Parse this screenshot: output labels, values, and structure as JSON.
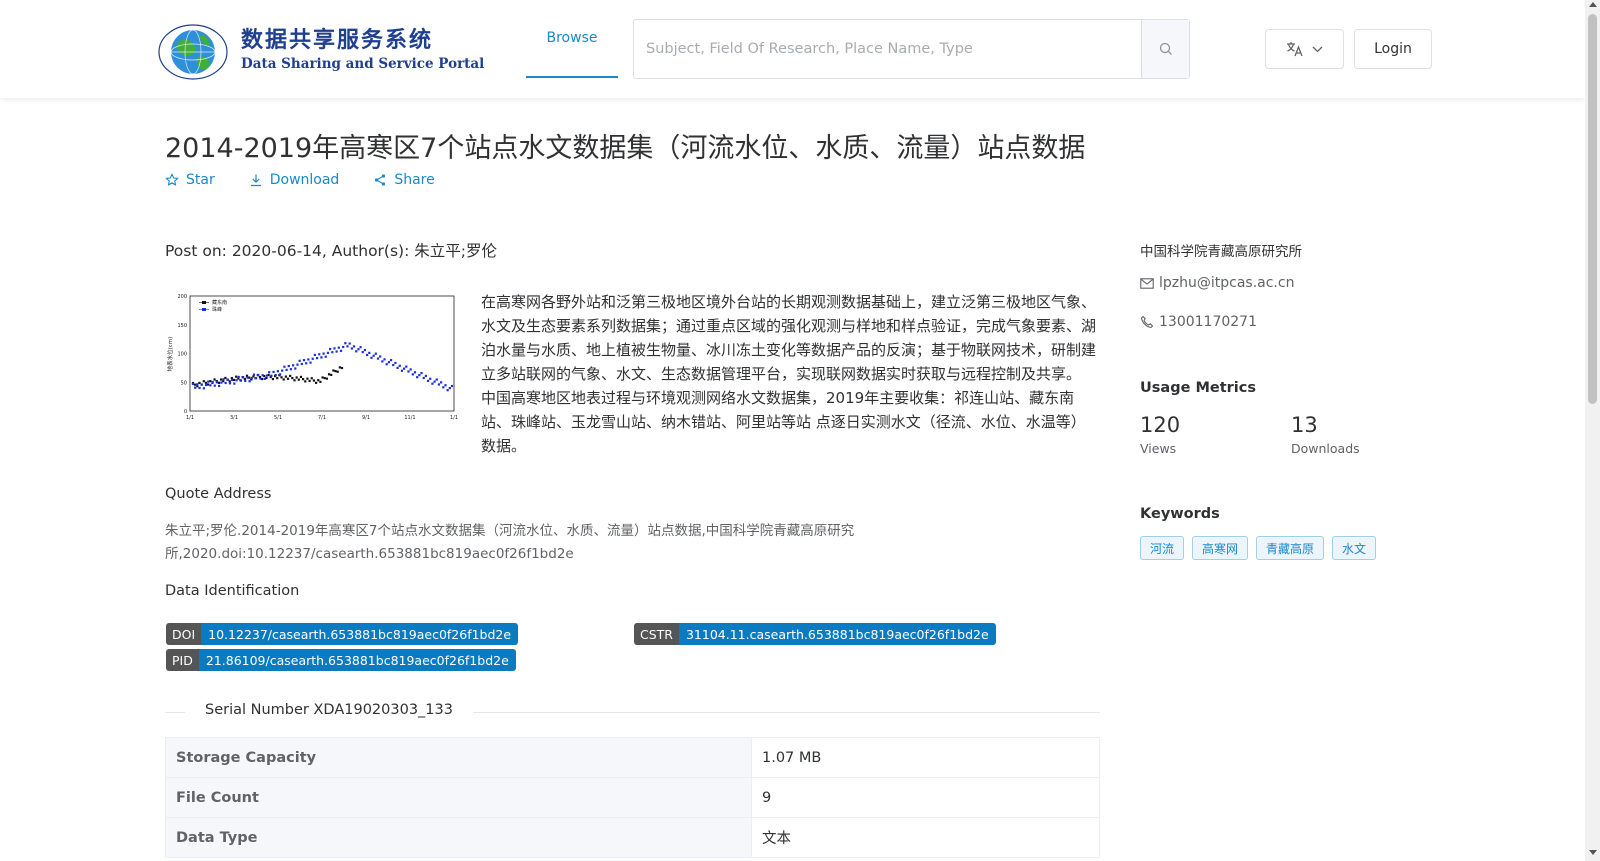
{
  "header": {
    "logo": {
      "cn": "数据共享服务系统",
      "en": "Data Sharing and Service Portal",
      "ring_text_top": "地球大数据科学数据中心",
      "ring_text_bottom": "Big Earth Data Center,CAS"
    },
    "nav_browse": "Browse",
    "search_placeholder": "Subject, Field Of Research, Place Name, Type",
    "login": "Login"
  },
  "dataset": {
    "title": "2014-2019年高寒区7个站点水文数据集（河流水位、水质、流量）站点数据",
    "actions": {
      "star": "Star",
      "download": "Download",
      "share": "Share"
    },
    "post_line": "Post on: 2020-06-14, Author(s): 朱立平;罗伦",
    "description": "在高寒网各野外站和泛第三极地区境外台站的长期观测数据基础上，建立泛第三极地区气象、水文及生态要素系列数据集；通过重点区域的强化观测与样地和样点验证，完成气象要素、湖泊水量与水质、地上植被生物量、冰川冻土变化等数据产品的反演；基于物联网技术，研制建立多站联网的气象、水文、生态数据管理平台，实现联网数据实时获取与远程控制及共享。 中国高寒地区地表过程与环境观测网络水文数据集，2019年主要收集：祁连山站、藏东南站、珠峰站、玉龙雪山站、纳木错站、阿里站等站 点逐日实测水文（径流、水位、水温等）数据。",
    "thumbnail": {
      "y_ticks": [
        "200",
        "150",
        "100",
        "50",
        "0"
      ],
      "x_ticks": [
        "1/1",
        "3/1",
        "5/1",
        "7/1",
        "9/1",
        "11/1",
        "1/1"
      ],
      "ylabel": "地表水位(cm)",
      "legend": [
        "藏东南",
        "珠峰"
      ],
      "series_colors": [
        "#111111",
        "#1a2ee0"
      ]
    },
    "quote_label": "Quote Address",
    "quote_text": "朱立平;罗伦.2014-2019年高寒区7个站点水文数据集（河流水位、水质、流量）站点数据,中国科学院青藏高原研究所,2020.doi:10.12237/casearth.653881bc819aec0f26f1bd2e",
    "identification_label": "Data Identification",
    "identifiers": {
      "doi": {
        "key": "DOI",
        "value": "10.12237/casearth.653881bc819aec0f26f1bd2e"
      },
      "cstr": {
        "key": "CSTR",
        "value": "31104.11.casearth.653881bc819aec0f26f1bd2e"
      },
      "pid": {
        "key": "PID",
        "value": "21.86109/casearth.653881bc819aec0f26f1bd2e"
      }
    },
    "serial": "Serial Number XDA19020303_133",
    "info": [
      {
        "key": "Storage Capacity",
        "value": "1.07 MB"
      },
      {
        "key": "File Count",
        "value": "9"
      },
      {
        "key": "Data Type",
        "value": "文本"
      }
    ]
  },
  "sidebar": {
    "org": "中国科学院青藏高原研究所",
    "email": "lpzhu@itpcas.ac.cn",
    "phone": "13001170271",
    "usage_heading": "Usage Metrics",
    "views": {
      "value": "120",
      "label": "Views"
    },
    "downloads": {
      "value": "13",
      "label": "Downloads"
    },
    "keywords_heading": "Keywords",
    "keywords": [
      "河流",
      "高寒网",
      "青藏高原",
      "水文"
    ]
  },
  "colors": {
    "accent": "#1989c9",
    "badge_value_bg": "#0a7bc1",
    "badge_key_bg": "#555555"
  },
  "icons": {
    "search": "search-icon",
    "translate": "translate-icon",
    "star": "star-icon",
    "download": "download-icon",
    "share": "share-icon",
    "mail": "mail-icon",
    "phone": "phone-icon"
  }
}
